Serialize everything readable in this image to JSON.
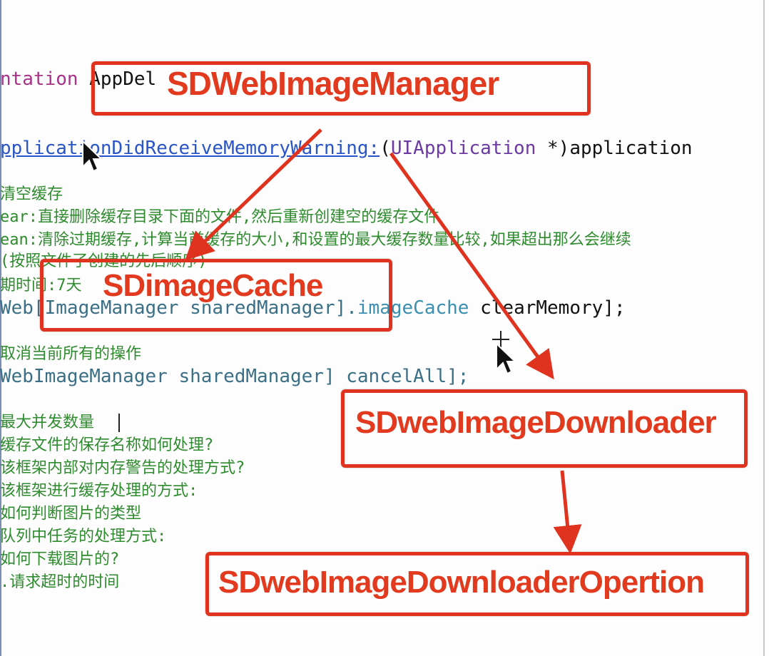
{
  "code": {
    "line_impl": {
      "kw": "ntation",
      "rest": " AppDel"
    },
    "line_method": {
      "link": "pplicationDidReceiveMemoryWarning:",
      "paren": "(",
      "cls": "UIApplication",
      "rest": " *)application"
    },
    "line_c1": "清空缓存",
    "line_c2": "ear:直接删除缓存目录下面的文件,然后重新创建空的缓存文件",
    "line_c3": "ean:清除过期缓存,计算当前缓存的大小,和设置的最大缓存数量比较,如果超出那么会继续",
    "line_c4": "(按照文件了创建的先后顺序)",
    "line_c5": "期时间:7天",
    "line_code1": {
      "a": "Web[ImageManager sharedManager].",
      "b": "imageCache",
      "c": " clearMemory];"
    },
    "line_c6": "取消当前所有的操作",
    "line_code2": "WebImageManager sharedManager] cancelAll];",
    "line_c7": "最大并发数量",
    "line_c8": "缓存文件的保存名称如何处理?",
    "line_c9": "该框架内部对内存警告的处理方式?",
    "line_c10": "该框架进行缓存处理的方式:",
    "line_c11": "如何判断图片的类型",
    "line_c12": "队列中任务的处理方式:",
    "line_c13": "如何下载图片的?",
    "line_c14": ".请求超时的时间"
  },
  "labels": {
    "manager": "SDWebImageManager",
    "cache": "SDimageCache",
    "downloader": "SDwebImageDownloader",
    "operation": "SDwebImageDownloaderOpertion"
  },
  "colors": {
    "annotation_red": "#e0331f",
    "comment_green": "#2e8b2e"
  },
  "icons": [
    "arrow-cursor-icon",
    "crosshair-cursor-icon"
  ]
}
